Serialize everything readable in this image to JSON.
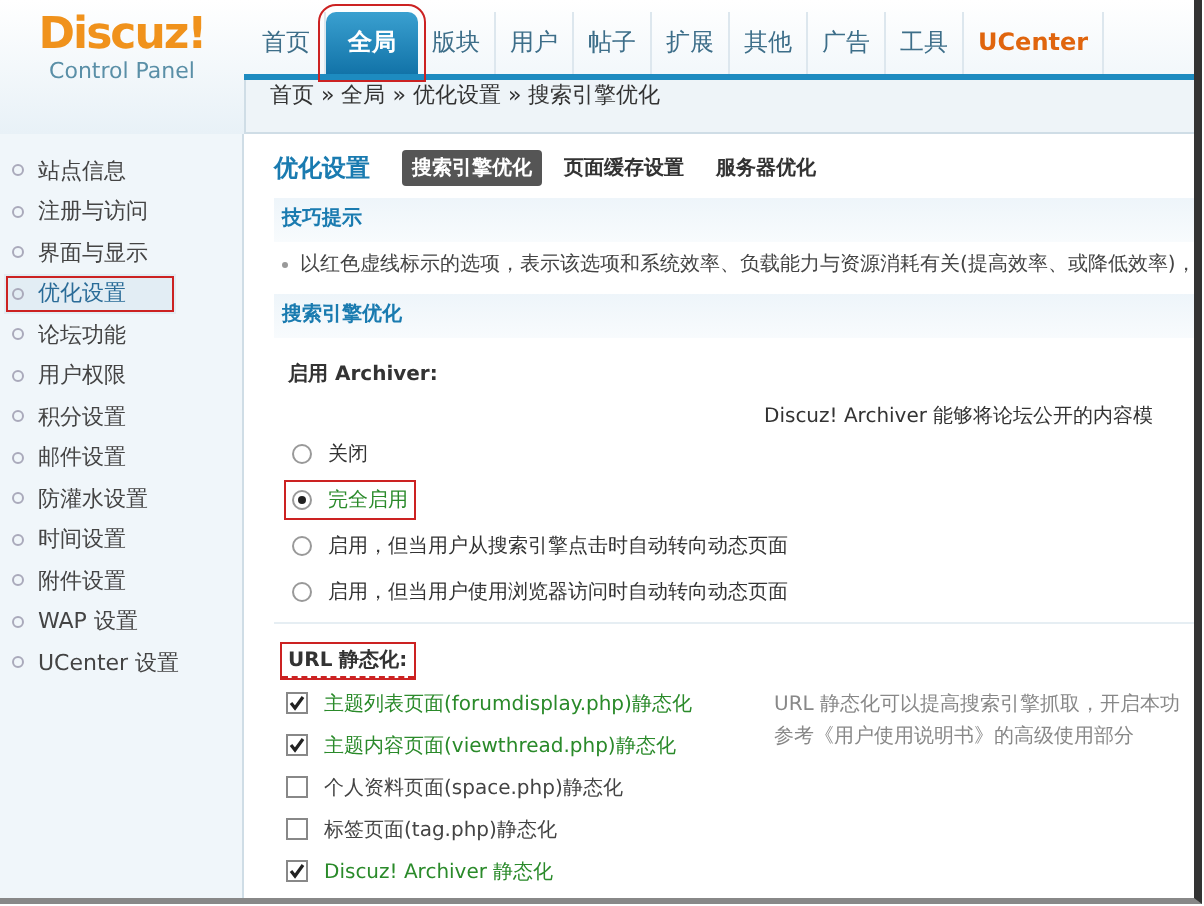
{
  "logo": {
    "title": "Discuz!",
    "subtitle": "Control Panel"
  },
  "nav": [
    {
      "label": "首页",
      "selected": false,
      "annotated": false,
      "kind": "plain"
    },
    {
      "label": "全局",
      "selected": true,
      "annotated": true,
      "kind": "plain"
    },
    {
      "label": "版块",
      "selected": false,
      "annotated": false,
      "kind": "plain"
    },
    {
      "label": "用户",
      "selected": false,
      "annotated": false,
      "kind": "plain"
    },
    {
      "label": "帖子",
      "selected": false,
      "annotated": false,
      "kind": "plain"
    },
    {
      "label": "扩展",
      "selected": false,
      "annotated": false,
      "kind": "plain"
    },
    {
      "label": "其他",
      "selected": false,
      "annotated": false,
      "kind": "plain"
    },
    {
      "label": "广告",
      "selected": false,
      "annotated": false,
      "kind": "plain"
    },
    {
      "label": "工具",
      "selected": false,
      "annotated": false,
      "kind": "plain"
    },
    {
      "label": "UCenter",
      "selected": false,
      "annotated": false,
      "kind": "accent"
    }
  ],
  "breadcrumb": "首页 » 全局 » 优化设置 » 搜索引擎优化",
  "sidebar": {
    "items": [
      {
        "label": "站点信息",
        "selected": false,
        "annotated": false
      },
      {
        "label": "注册与访问",
        "selected": false,
        "annotated": false
      },
      {
        "label": "界面与显示",
        "selected": false,
        "annotated": false
      },
      {
        "label": "优化设置",
        "selected": true,
        "annotated": true
      },
      {
        "label": "论坛功能",
        "selected": false,
        "annotated": false
      },
      {
        "label": "用户权限",
        "selected": false,
        "annotated": false
      },
      {
        "label": "积分设置",
        "selected": false,
        "annotated": false
      },
      {
        "label": "邮件设置",
        "selected": false,
        "annotated": false
      },
      {
        "label": "防灌水设置",
        "selected": false,
        "annotated": false
      },
      {
        "label": "时间设置",
        "selected": false,
        "annotated": false
      },
      {
        "label": "附件设置",
        "selected": false,
        "annotated": false
      },
      {
        "label": "WAP 设置",
        "selected": false,
        "annotated": false
      },
      {
        "label": "UCenter 设置",
        "selected": false,
        "annotated": false
      }
    ]
  },
  "page": {
    "title": "优化设置",
    "subtabs": [
      {
        "label": "搜索引擎优化",
        "selected": true
      },
      {
        "label": "页面缓存设置",
        "selected": false
      },
      {
        "label": "服务器优化",
        "selected": false
      }
    ]
  },
  "tips": {
    "heading": "技巧提示",
    "items": [
      "以红色虚线标示的选项，表示该选项和系统效率、负载能力与资源消耗有关(提高效率、或降低效率)，"
    ]
  },
  "section": {
    "heading": "搜索引擎优化"
  },
  "archiver": {
    "label": "启用  Archiver:",
    "annotated": false,
    "dashed": false,
    "description": "Discuz! Archiver 能够将论坛公开的内容模",
    "options": [
      {
        "label": "关闭",
        "selected": false,
        "annotated": false
      },
      {
        "label": "完全启用",
        "selected": true,
        "annotated": true
      },
      {
        "label": "启用，但当用户从搜索引擎点击时自动转向动态页面",
        "selected": false,
        "annotated": false
      },
      {
        "label": "启用，但当用户使用浏览器访问时自动转向动态页面",
        "selected": false,
        "annotated": false
      }
    ]
  },
  "url_static": {
    "label": "URL 静态化:",
    "annotated": true,
    "dashed": true,
    "description": [
      "URL 静态化可以提高搜索引擎抓取，开启本功",
      "参考《用户使用说明书》的高级使用部分"
    ],
    "options": [
      {
        "label": "主题列表页面(forumdisplay.php)静态化",
        "checked": true
      },
      {
        "label": "主题内容页面(viewthread.php)静态化",
        "checked": true
      },
      {
        "label": "个人资料页面(space.php)静态化",
        "checked": false
      },
      {
        "label": "标签页面(tag.php)静态化",
        "checked": false
      },
      {
        "label": "Discuz! Archiver 静态化",
        "checked": true
      }
    ]
  }
}
